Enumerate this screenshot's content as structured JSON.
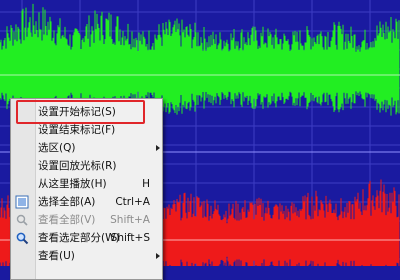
{
  "context_menu": {
    "items": [
      {
        "label": "设置开始标记(S)"
      },
      {
        "label": "设置结束标记(F)"
      },
      {
        "label": "选区(Q)",
        "has_submenu": true
      },
      {
        "label": "设置回放光标(R)"
      },
      {
        "label": "从这里播放(H)",
        "shortcut": "H"
      },
      {
        "label": "选择全部(A)",
        "shortcut": "Ctrl+A",
        "icon": "select-all-icon"
      },
      {
        "label": "查看全部(V)",
        "shortcut": "Shift+A",
        "icon": "view-all-icon",
        "disabled": true
      },
      {
        "label": "查看选定部分(W)",
        "shortcut": "Shift+S",
        "icon": "zoom-selection-icon"
      },
      {
        "label": "查看(U)",
        "has_submenu": true
      }
    ]
  },
  "colors": {
    "background": "#1a1aa0",
    "top_channel_wave": "#22ee22",
    "bottom_channel_wave": "#ee1a1a",
    "highlight": "#e0262a"
  }
}
